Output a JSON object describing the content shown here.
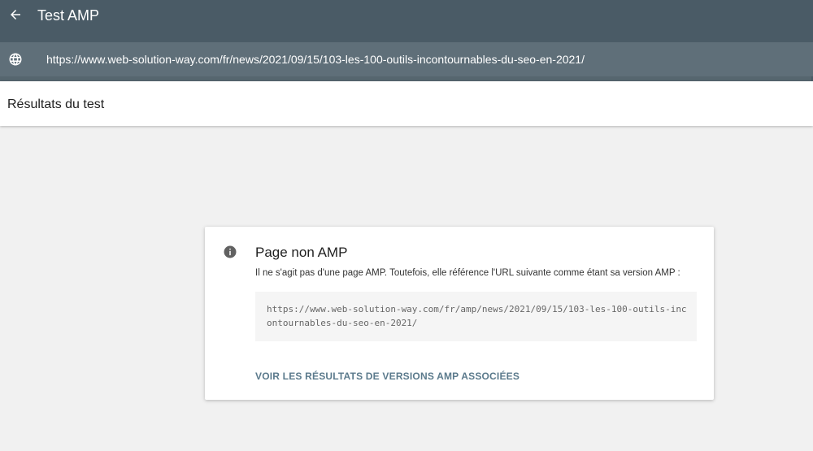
{
  "header": {
    "title": "Test AMP",
    "back_icon": "arrow-left-icon"
  },
  "url_bar": {
    "icon": "globe-icon",
    "url": "https://www.web-solution-way.com/fr/news/2021/09/15/103-les-100-outils-incontournables-du-seo-en-2021/"
  },
  "results": {
    "heading": "Résultats du test"
  },
  "card": {
    "icon": "info-icon",
    "title": "Page non AMP",
    "description": "Il ne s'agit pas d'une page AMP. Toutefois, elle référence l'URL suivante comme étant sa version AMP :",
    "amp_url": "https://www.web-solution-way.com/fr/amp/news/2021/09/15/103-les-100-outils-incontournables-du-seo-en-2021/",
    "link_label": "VOIR LES RÉSULTATS DE VERSIONS AMP ASSOCIÉES"
  },
  "colors": {
    "topbar": "#4a5b66",
    "urlbar": "#5f6f79",
    "link": "#5b7a8c",
    "background": "#f1f1f1"
  }
}
